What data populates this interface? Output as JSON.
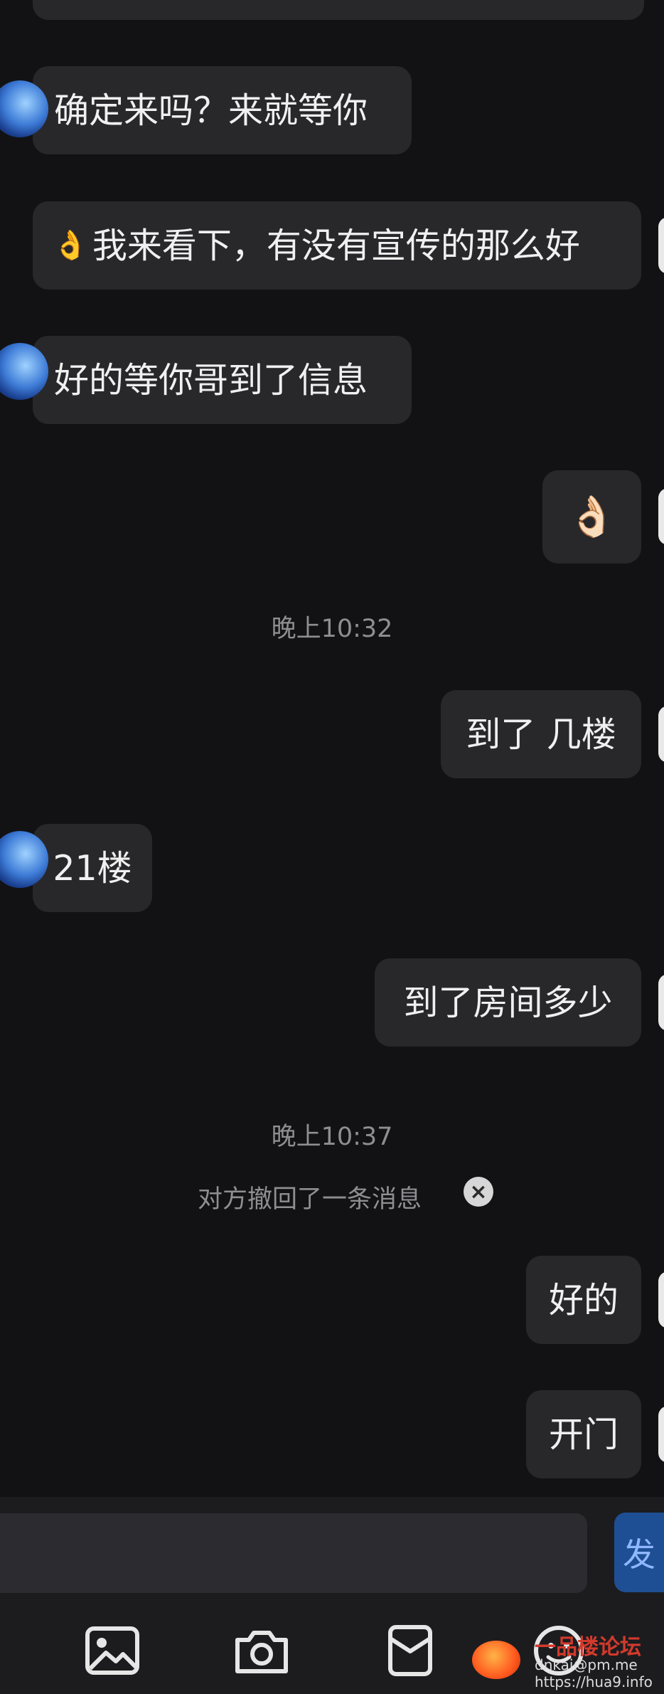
{
  "messages": {
    "m1": "确定来吗？来就等你",
    "m2_emoji": "👌",
    "m2_text": "我来看下，有没有宣传的那么好",
    "m3": "好的等你哥到了信息",
    "m4_emoji": "👌🏻",
    "m5": "到了 几楼",
    "m6": "21楼",
    "m7": "到了房间多少",
    "m8": "好的",
    "m9": "开门"
  },
  "timestamps": {
    "t1": "晚上10:32",
    "t2": "晚上10:37"
  },
  "notice": {
    "recall_text": "对方撤回了一条消息",
    "dismiss_glyph": "×"
  },
  "input": {
    "send_label_partial": "发"
  },
  "watermark": {
    "line1": "一品楼论坛",
    "line2": "dnkai@pm.me",
    "line3": "https://hua9.info"
  },
  "colors": {
    "background": "#121214",
    "bubble": "#28282b",
    "send_button": "#1e4f95",
    "muted_text": "#8e8e93"
  }
}
